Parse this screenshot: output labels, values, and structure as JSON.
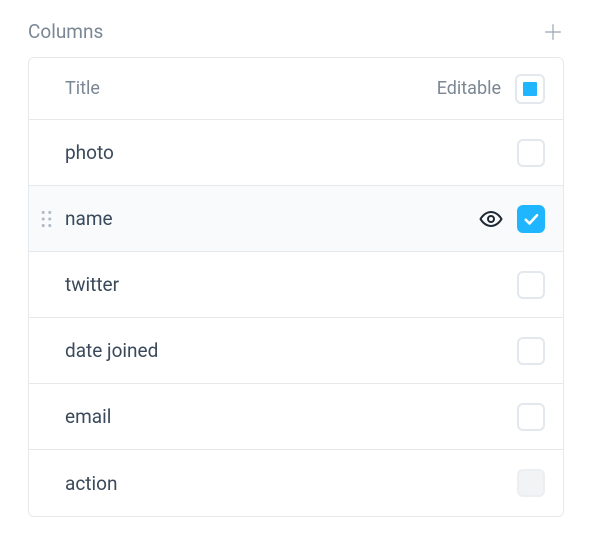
{
  "section": {
    "title": "Columns"
  },
  "table": {
    "headers": {
      "title": "Title",
      "editable": "Editable"
    },
    "rows": [
      {
        "title": "photo",
        "checked": false,
        "hover": false,
        "grey": false
      },
      {
        "title": "name",
        "checked": true,
        "hover": true,
        "grey": false
      },
      {
        "title": "twitter",
        "checked": false,
        "hover": false,
        "grey": false
      },
      {
        "title": "date joined",
        "checked": false,
        "hover": false,
        "grey": false
      },
      {
        "title": "email",
        "checked": false,
        "hover": false,
        "grey": false
      },
      {
        "title": "action",
        "checked": false,
        "hover": false,
        "grey": true
      }
    ]
  }
}
